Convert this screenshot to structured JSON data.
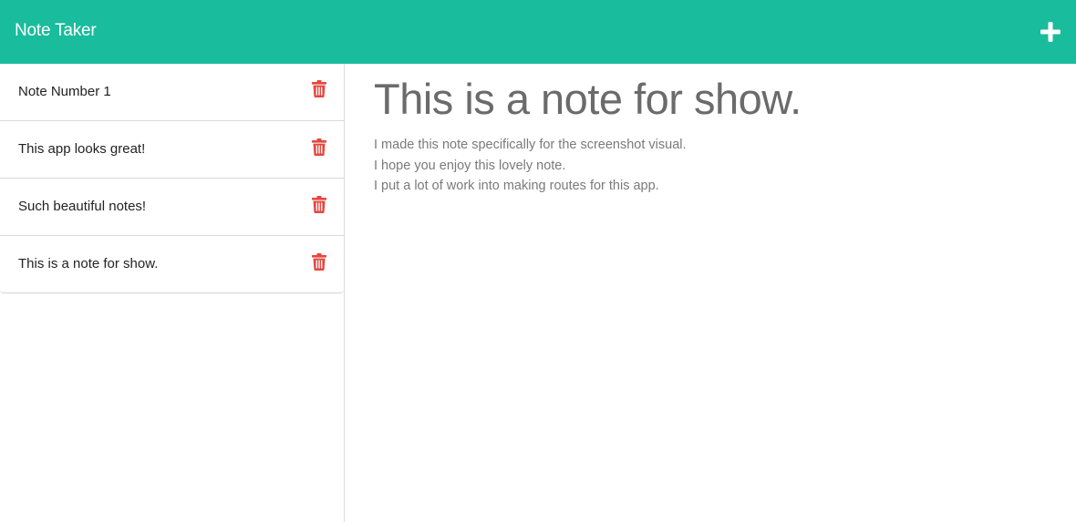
{
  "app": {
    "title": "Note Taker"
  },
  "header": {
    "add_icon": "plus-icon"
  },
  "sidebar": {
    "notes": [
      {
        "title": "Note Number 1"
      },
      {
        "title": "This app looks great!"
      },
      {
        "title": "Such beautiful notes!"
      },
      {
        "title": "This is a note for show."
      }
    ],
    "delete_icon": "trash-icon"
  },
  "active_note": {
    "title": "This is a note for show.",
    "body_lines": [
      "I made this note specifically for the screenshot visual.",
      "I hope you enjoy this lovely note.",
      "I put a lot of work into making routes for this app."
    ]
  },
  "colors": {
    "header": "#19bc9c",
    "delete_icon": "#e5473f",
    "heading_text": "#6b6b6b",
    "body_text": "#7a7a7a"
  }
}
